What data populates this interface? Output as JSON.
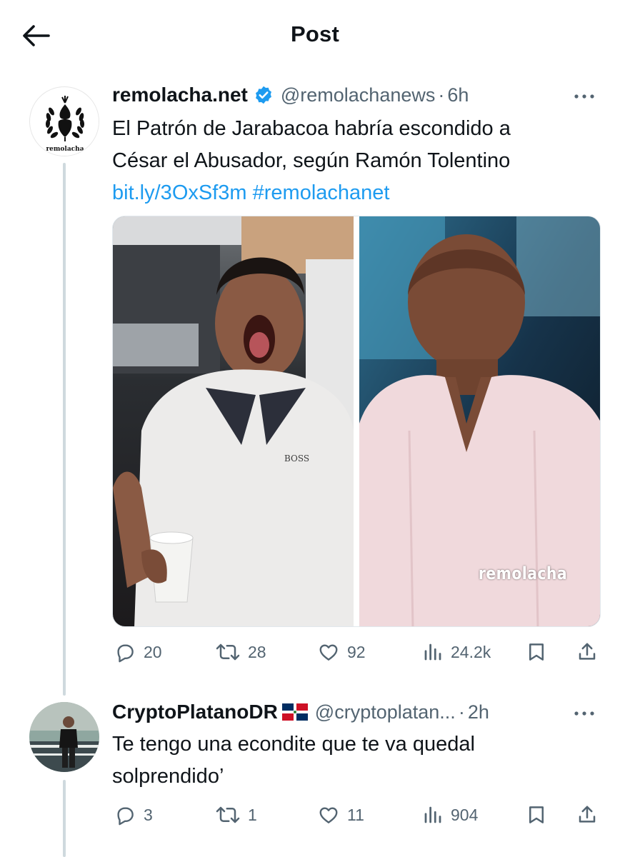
{
  "header": {
    "title": "Post",
    "back_icon": "arrow-left-icon"
  },
  "posts": [
    {
      "display_name": "remolacha.net",
      "verified": true,
      "handle": "@remolachanews",
      "separator": "·",
      "time": "6h",
      "avatar_label": "remolacha",
      "text_line1": "El Patrón de Jarabacoa habría escondido a",
      "text_line2": "César el Abusador, según Ramón Tolentino",
      "link": "bit.ly/3OxSf3m",
      "hashtag": "#remolachanet",
      "media_watermark": "remolacha",
      "media_left_logo": "BOSS",
      "stats": {
        "replies": "20",
        "reposts": "28",
        "likes": "92",
        "views": "24.2k"
      }
    },
    {
      "display_name": "CryptoPlatanoDR",
      "flag": "dominican-republic-flag",
      "handle": "@cryptoplatan...",
      "separator": "·",
      "time": "2h",
      "text_line1": "Te tengo una econdite que te va quedal",
      "text_line2": "solprendido’",
      "stats": {
        "replies": "3",
        "reposts": "1",
        "likes": "11",
        "views": "904"
      }
    }
  ],
  "colors": {
    "accent": "#1d9bf0",
    "secondary_text": "#536471",
    "thread_line": "#cfd9de"
  }
}
